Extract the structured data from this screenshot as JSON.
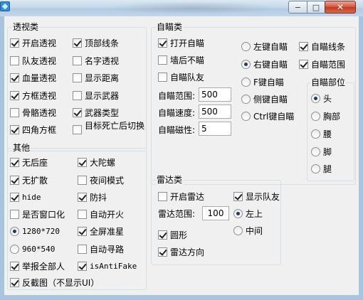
{
  "window": {
    "controls": {
      "minimize": "−",
      "maximize": "□",
      "close": "✕"
    }
  },
  "perspective": {
    "title": "透视类",
    "items": [
      {
        "label": "开启透视",
        "checked": true
      },
      {
        "label": "顶部线条",
        "checked": true
      },
      {
        "label": "队友透视",
        "checked": false
      },
      {
        "label": "名字透视",
        "checked": false
      },
      {
        "label": "血量透视",
        "checked": true
      },
      {
        "label": "显示距离",
        "checked": false
      },
      {
        "label": "方框透视",
        "checked": true
      },
      {
        "label": "显示武器",
        "checked": false
      },
      {
        "label": "骨骼透视",
        "checked": false
      },
      {
        "label": "武器类型",
        "checked": true
      },
      {
        "label": "四角方框",
        "checked": true
      },
      {
        "label": "目标死亡后切换",
        "checked": false
      }
    ]
  },
  "other": {
    "title": "其他",
    "checks": [
      {
        "label": "无后座",
        "checked": true
      },
      {
        "label": "大陀螺",
        "checked": true
      },
      {
        "label": "无扩散",
        "checked": true
      },
      {
        "label": "夜间模式",
        "checked": false
      },
      {
        "label": "hide",
        "checked": true
      },
      {
        "label": "防抖",
        "checked": true
      },
      {
        "label": "是否窗口化",
        "checked": false
      },
      {
        "label": "自动开火",
        "checked": false
      },
      {
        "label": "全屏准星",
        "checked": true
      },
      {
        "label": "自动寻路",
        "checked": false
      },
      {
        "label": "举报全部人",
        "checked": true
      },
      {
        "label": "isAntiFake",
        "checked": true
      },
      {
        "label": "反截图（不显示UI）",
        "checked": true
      }
    ],
    "resolutions": [
      {
        "label": "1280*720",
        "selected": true
      },
      {
        "label": "960*540",
        "selected": false
      }
    ]
  },
  "aimbot": {
    "title": "自瞄类",
    "checks": [
      {
        "label": "打开自瞄",
        "checked": true
      },
      {
        "label": "墙后不瞄",
        "checked": false
      },
      {
        "label": "自瞄队友",
        "checked": false
      }
    ],
    "keys": [
      {
        "label": "左键自瞄",
        "selected": false
      },
      {
        "label": "右键自瞄",
        "selected": true
      },
      {
        "label": "F键自瞄",
        "selected": false
      },
      {
        "label": "侧键自瞄",
        "selected": false
      },
      {
        "label": "Ctrl键自瞄",
        "selected": false
      }
    ],
    "extra": [
      {
        "label": "自瞄线条",
        "checked": true
      },
      {
        "label": "自瞄范围",
        "checked": true
      }
    ],
    "fields": [
      {
        "label": "自瞄范围:",
        "value": "500"
      },
      {
        "label": "自瞄速度:",
        "value": "500"
      },
      {
        "label": "自瞄磁性:",
        "value": "5"
      }
    ],
    "body_part": {
      "title": "自瞄部位",
      "options": [
        {
          "label": "头",
          "selected": true
        },
        {
          "label": "胸部",
          "selected": false
        },
        {
          "label": "腰",
          "selected": false
        },
        {
          "label": "脚",
          "selected": false
        },
        {
          "label": "腿",
          "selected": false
        }
      ]
    }
  },
  "radar": {
    "title": "雷达类",
    "checks": [
      {
        "label": "开启雷达",
        "checked": false
      },
      {
        "label": "显示队友",
        "checked": true
      },
      {
        "label": "圆形",
        "checked": true
      },
      {
        "label": "雷达方向",
        "checked": true
      }
    ],
    "range_label": "雷达范围:",
    "range_value": "100",
    "position": [
      {
        "label": "左上",
        "selected": true
      },
      {
        "label": "中间",
        "selected": false
      }
    ]
  }
}
